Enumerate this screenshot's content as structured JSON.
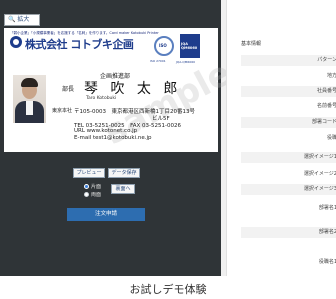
{
  "editor": {
    "zoom_label": "拡大",
    "card": {
      "tagline": "「弱小企業」「小規模事業者」を応援する「名刺」を作ります。Card maker Kotobuki Printer",
      "company": "株式会社 コトブキ企画",
      "cert1_text": "ISO",
      "cert1_caption": "ISO 27001",
      "cert2_text": "JQA QM6060",
      "cert2_caption": "JQA-QM6060",
      "watermark": "sample",
      "department": "企画推進部",
      "position": "部長",
      "name": "琴 吹 太 郎",
      "name_roman": "Taro Kotobuki",
      "office_label": "東京本社",
      "address1": "〒105-0003　東京都港区西新橋1丁目20番13号",
      "address2": "ビル5F",
      "tel": "TEL 03-5251-0025　FAX 03-5251-0026",
      "url": "URL www.kotonet.co.jp",
      "email": "E-mail test1@kotobuki.ne.jp"
    },
    "preview_label": "プレビュー",
    "save_label": "データ保存",
    "side_front": "片面",
    "side_both": "両面",
    "back_label": "裏面へ",
    "order_label": "注文申請"
  },
  "form": {
    "section_title": "基本情報",
    "rows": [
      "パターン",
      "地方",
      "社員番号",
      "名前番号",
      "部署コード",
      "役職",
      "選択イメージ1",
      "選択イメージ2",
      "選択イメージ3",
      "部署名1",
      "部署名2",
      "役職名1"
    ]
  },
  "caption": "お試しデモ体験"
}
